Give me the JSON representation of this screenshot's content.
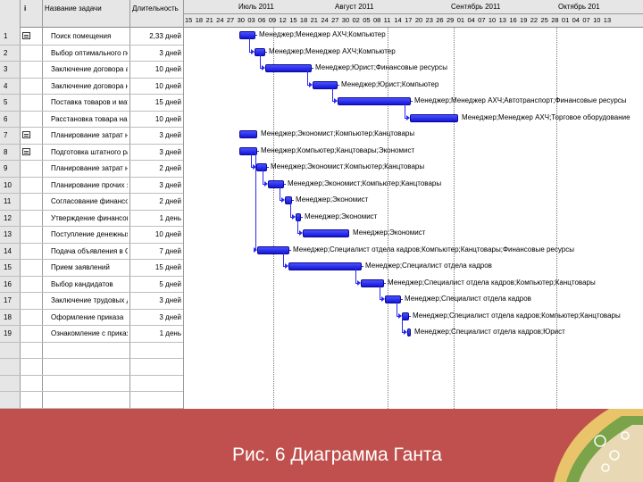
{
  "table": {
    "header_icon": "i",
    "col_name": "Название задачи",
    "col_duration": "Длительность",
    "rows": [
      {
        "id": "1",
        "name": "Поиск помещения",
        "dur": "2,33 дней",
        "note": true
      },
      {
        "id": "2",
        "name": "Выбор оптимального пом",
        "dur": "3 дней",
        "note": false
      },
      {
        "id": "3",
        "name": "Заключение договора ар",
        "dur": "10 дней",
        "note": false
      },
      {
        "id": "4",
        "name": "Заключение договора на",
        "dur": "10 дней",
        "note": false
      },
      {
        "id": "5",
        "name": "Поставка товаров и мат",
        "dur": "15 дней",
        "note": false
      },
      {
        "id": "6",
        "name": "Расстановка товара на в",
        "dur": "10 дней",
        "note": false
      },
      {
        "id": "7",
        "name": "Планирование затрат на",
        "dur": "3 дней",
        "note": true
      },
      {
        "id": "8",
        "name": "Подготовка штатного рас",
        "dur": "3 дней",
        "note": true
      },
      {
        "id": "9",
        "name": "Планирование затрат на",
        "dur": "2 дней",
        "note": false
      },
      {
        "id": "10",
        "name": "Планирование прочих за",
        "dur": "3 дней",
        "note": false
      },
      {
        "id": "11",
        "name": "Согласование финансово",
        "dur": "2 дней",
        "note": false
      },
      {
        "id": "12",
        "name": "Утверждение финансово",
        "dur": "1 день",
        "note": false
      },
      {
        "id": "13",
        "name": "Поступление денежных с",
        "dur": "10 дней",
        "note": false
      },
      {
        "id": "14",
        "name": "Подача объявления в СМ",
        "dur": "7 дней",
        "note": false
      },
      {
        "id": "15",
        "name": "Прием заявлений",
        "dur": "15 дней",
        "note": false
      },
      {
        "id": "16",
        "name": "Выбор кандидатов",
        "dur": "5 дней",
        "note": false
      },
      {
        "id": "17",
        "name": "Заключение трудовых до",
        "dur": "3 дней",
        "note": false
      },
      {
        "id": "18",
        "name": "Оформление приказа",
        "dur": "3 дней",
        "note": false
      },
      {
        "id": "19",
        "name": "Ознакомление с приказо",
        "dur": "1 день",
        "note": false
      }
    ]
  },
  "timeline": {
    "months": [
      "Июль 2011",
      "Август 2011",
      "Сентябрь 2011",
      "Октябрь 201"
    ],
    "days": [
      "15",
      "18",
      "21",
      "24",
      "27",
      "30",
      "03",
      "06",
      "09",
      "12",
      "15",
      "18",
      "21",
      "24",
      "27",
      "30",
      "02",
      "05",
      "08",
      "11",
      "14",
      "17",
      "20",
      "23",
      "26",
      "29",
      "01",
      "04",
      "07",
      "10",
      "13",
      "16",
      "19",
      "22",
      "25",
      "28",
      "01",
      "04",
      "07",
      "10",
      "13"
    ]
  },
  "bars": [
    {
      "label": "Менеджер;Менеджер АХЧ;Компьютер"
    },
    {
      "label": "Менеджер;Менеджер АХЧ;Компьютер"
    },
    {
      "label": "Менеджер;Юрист;Финансовые ресурсы"
    },
    {
      "label": "Менеджер;Юрист;Компьютер"
    },
    {
      "label": "Менеджер;Менеджер АХЧ;Автотранспорт;Финансовые ресурсы"
    },
    {
      "label": "Менеджер;Менеджер АХЧ;Торговое оборудование"
    },
    {
      "label": "Менеджер;Экономист;Компьютер;Канцтовары"
    },
    {
      "label": "Менеджер;Компьютер;Канцтовары;Экономист"
    },
    {
      "label": "Менеджер;Экономист;Компьютер;Канцтовары"
    },
    {
      "label": "Менеджер;Экономист;Компьютер;Канцтовары"
    },
    {
      "label": "Менеджер;Экономист"
    },
    {
      "label": "Менеджер;Экономист"
    },
    {
      "label": "Менеджер;Экономист"
    },
    {
      "label": "Менеджер;Специалист отдела кадров;Компьютер;Канцтовары;Финансовые ресурсы"
    },
    {
      "label": "Менеджер;Специалист отдела кадров"
    },
    {
      "label": "Менеджер;Специалист отдела кадров;Компьютер;Канцтовары"
    },
    {
      "label": "Менеджер;Специалист отдела кадров"
    },
    {
      "label": "Менеджер;Специалист отдела кадров;Компьютер;Канцтовары"
    },
    {
      "label": "Менеджер;Специалист отдела кадров;Юрист"
    }
  ],
  "caption": "Рис. 6 Диаграмма Ганта",
  "colors": {
    "bar": "#2020e8",
    "banner": "#c0504d",
    "header": "#e6e6e6"
  }
}
